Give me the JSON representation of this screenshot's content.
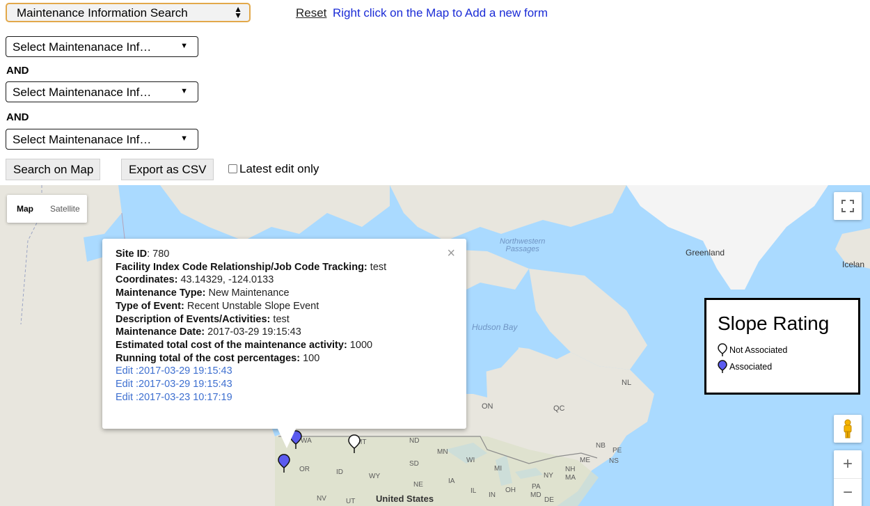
{
  "toolbar": {
    "mode_select": "Maintenance Information Search",
    "reset_link": "Reset",
    "add_form_hint": "Right click on the Map to Add a new form",
    "filters": [
      "Select Maintenanace Inf…",
      "Select Maintenanace Inf…",
      "Select Maintenanace Inf…"
    ],
    "and_label": "AND",
    "search_button": "Search on Map",
    "export_button": "Export as CSV",
    "latest_edit_label": "Latest edit only",
    "latest_edit_checked": false
  },
  "map": {
    "type_buttons": [
      "Map",
      "Satellite"
    ],
    "active_type": "Map",
    "labels": {
      "greenland": "Greenland",
      "iceland": "Icelan",
      "northwestern_passages": "Northwestern\nPassages",
      "hudson_bay": "Hudson Bay",
      "on": "ON",
      "qc": "QC",
      "nl": "NL",
      "nb": "NB",
      "pe": "PE",
      "ns": "NS",
      "wa": "WA",
      "mt": "MT",
      "nd": "ND",
      "mn": "MN",
      "sd": "SD",
      "wi": "WI",
      "mi": "MI",
      "or": "OR",
      "id": "ID",
      "wy": "WY",
      "ne": "NE",
      "ia": "IA",
      "il": "IL",
      "in": "IN",
      "oh": "OH",
      "pa": "PA",
      "ny": "NY",
      "me": "ME",
      "nh": "NH",
      "ma": "MA",
      "md": "MD",
      "de": "DE",
      "nv": "NV",
      "ut": "UT",
      "united_states": "United States"
    },
    "zoom_in": "+",
    "zoom_out": "−",
    "fullscreen_icon": "fullscreen-icon",
    "pegman_icon": "pegman-icon",
    "colors": {
      "water": "#aadaff",
      "land": "#e8e6de",
      "greenland_ice": "#f4f4f4",
      "marker_associated": "#5b5bf0"
    }
  },
  "popup": {
    "site_id_label": "Site ID",
    "site_id_value": ": 780",
    "facility_label": "Facility Index Code Relationship/Job Code Tracking:",
    "facility_value": " test",
    "coordinates_label": "Coordinates:",
    "coordinates_value": " 43.14329, -124.0133",
    "maintenance_type_label": "Maintenance Type:",
    "maintenance_type_value": " New Maintenance",
    "event_type_label": "Type of Event:",
    "event_type_value": " Recent Unstable Slope Event",
    "description_label": "Description of Events/Activities:",
    "description_value": " test",
    "date_label": "Maintenance Date:",
    "date_value": " 2017-03-29 19:15:43",
    "cost_label": "Estimated total cost of the maintenance activity:",
    "cost_value": " 1000",
    "running_total_label": "Running total of the cost percentages:",
    "running_total_value": " 100",
    "edit_links": [
      "Edit :2017-03-29 19:15:43",
      "Edit :2017-03-29 19:15:43",
      "Edit :2017-03-23 10:17:19"
    ],
    "close": "×"
  },
  "legend": {
    "title": "Slope Rating",
    "not_associated": "Not Associated",
    "associated": "Associated"
  }
}
